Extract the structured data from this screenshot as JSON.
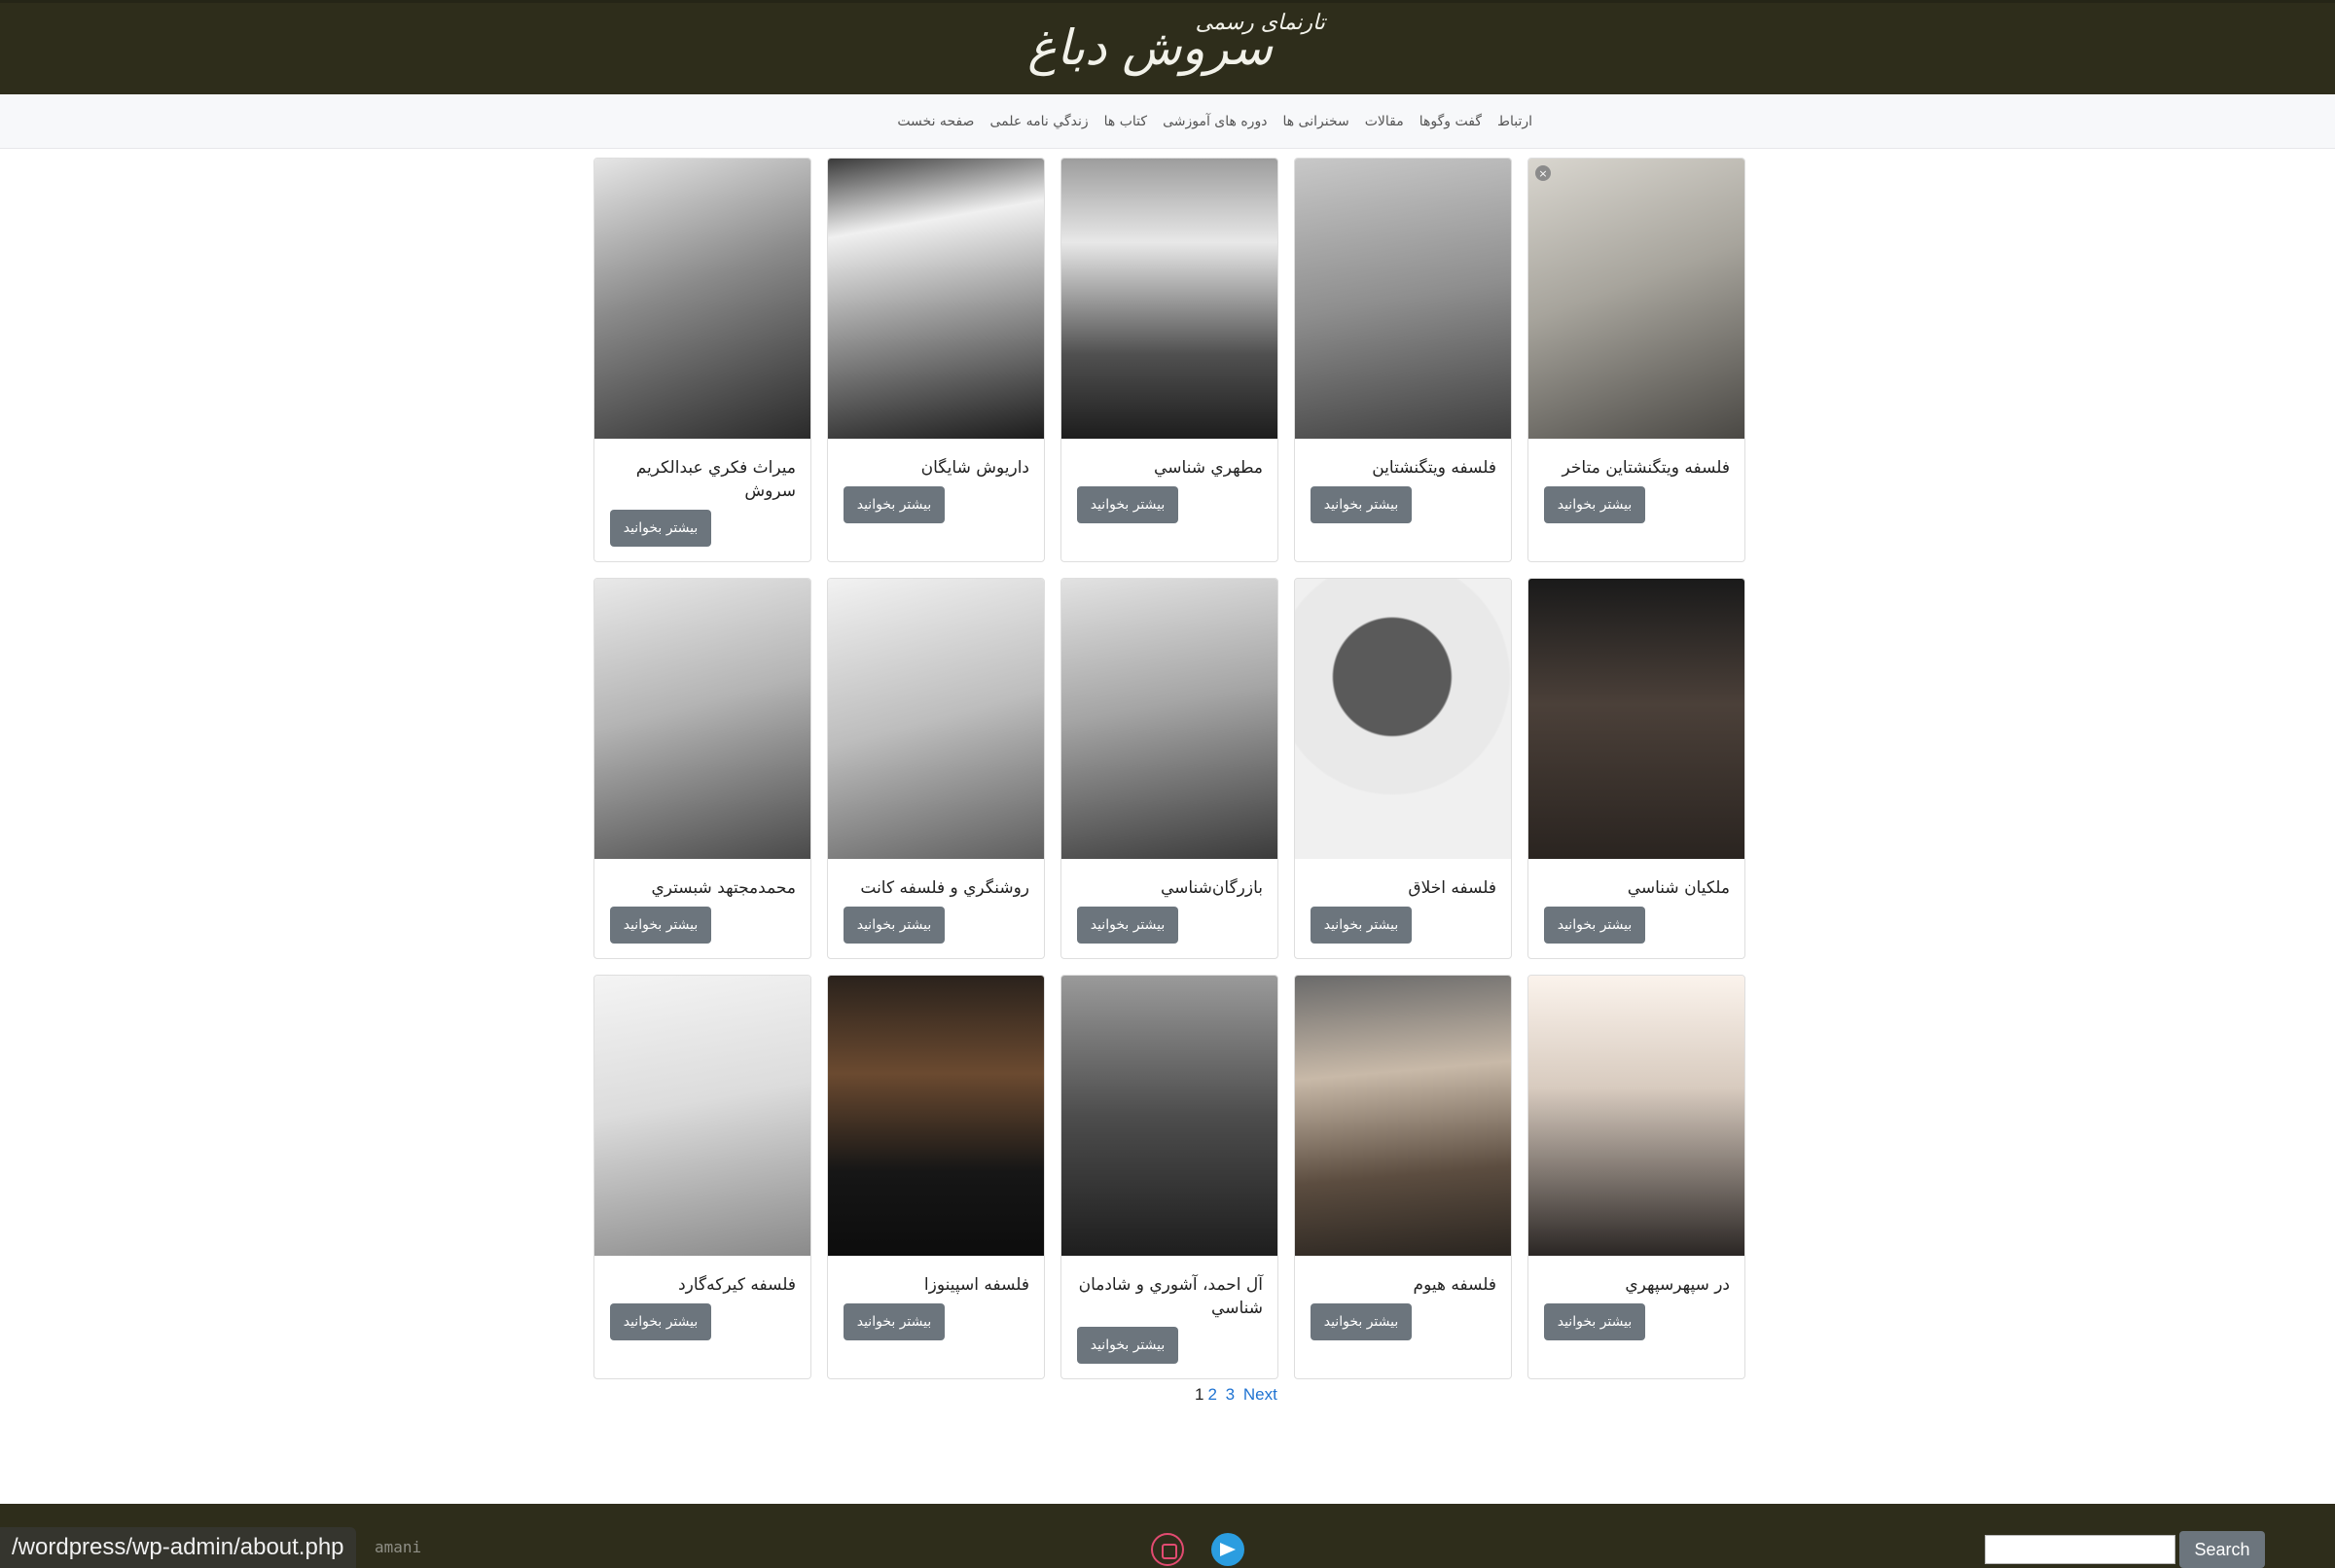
{
  "header": {
    "logo_main": "سروش دباغ",
    "logo_sub": "تارنمای رسمی"
  },
  "nav": {
    "items": [
      {
        "label": "صفحه نخست"
      },
      {
        "label": "زندگي نامه علمی"
      },
      {
        "label": "کتاب ها"
      },
      {
        "label": "دوره های آموزشی"
      },
      {
        "label": "سخنرانی ها"
      },
      {
        "label": "مقالات"
      },
      {
        "label": "گفت وگوها"
      },
      {
        "label": "ارتباط"
      }
    ]
  },
  "cards": [
    {
      "title": "فلسفه ويتگنشتاين متاخر",
      "button": "بيشتر بخوانيد",
      "image": "portrait-wittgenstein-late"
    },
    {
      "title": "فلسفه ويتگنشتاين",
      "button": "بيشتر بخوانيد",
      "image": "portrait-wittgenstein"
    },
    {
      "title": "مطهري شناسي",
      "button": "بيشتر بخوانيد",
      "image": "portrait-motahari"
    },
    {
      "title": "داريوش شايگان",
      "button": "بيشتر بخوانيد",
      "image": "portrait-shayegan"
    },
    {
      "title": "ميراث فكري عبدالكريم سروش",
      "button": "بيشتر بخوانيد",
      "image": "portrait-soroush"
    },
    {
      "title": "ملكيان شناسي",
      "button": "بيشتر بخوانيد",
      "image": "portrait-malekian"
    },
    {
      "title": "فلسفه اخلاق",
      "button": "بيشتر بخوانيد",
      "image": "ethics-book-cover"
    },
    {
      "title": "بازرگان‌شناسي",
      "button": "بيشتر بخوانيد",
      "image": "portrait-bazargan"
    },
    {
      "title": "روشنگري و فلسفه کانت",
      "button": "بيشتر بخوانيد",
      "image": "portrait-kant"
    },
    {
      "title": "محمدمجتهد شبستري",
      "button": "بيشتر بخوانيد",
      "image": "portrait-shabestari"
    },
    {
      "title": "در سپهرسپهري",
      "button": "بيشتر بخوانيد",
      "image": "portrait-sepehri"
    },
    {
      "title": "فلسفه هيوم",
      "button": "بيشتر بخوانيد",
      "image": "portrait-hume"
    },
    {
      "title": "آل احمد، آشوري و شادمان شناسي",
      "button": "بيشتر بخوانيد",
      "image": "portrait-trio"
    },
    {
      "title": "فلسفه اسپينوزا",
      "button": "بيشتر بخوانيد",
      "image": "portrait-spinoza"
    },
    {
      "title": "فلسفه كيركه‌گارد",
      "button": "بيشتر بخوانيد",
      "image": "portrait-kierkegaard"
    }
  ],
  "pagination": {
    "current": "1",
    "pages": [
      "2",
      "3"
    ],
    "next": "Next"
  },
  "footer": {
    "status_url": "/wordpress/wp-admin/about.php",
    "credit": "amani",
    "search_button": "Search",
    "social": [
      "instagram-icon",
      "telegram-icon"
    ]
  }
}
